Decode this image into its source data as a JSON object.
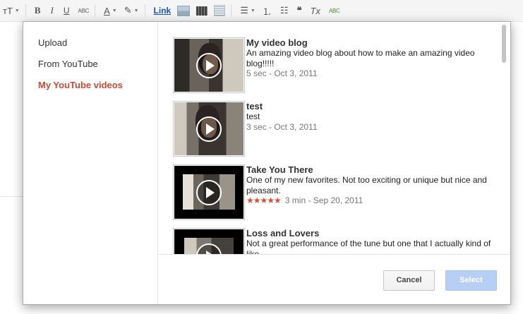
{
  "toolbar": {
    "font_size_label": "тT",
    "bold_label": "B",
    "italic_label": "I",
    "underline_label": "U",
    "strikethrough_label": "ABC",
    "text_color_label": "A",
    "link_label": "Link",
    "quote_label": "66",
    "clear_format_label": "Tx",
    "spellcheck_label": "ABC"
  },
  "dialog": {
    "sidebar": {
      "items": [
        {
          "label": "Upload",
          "active": false
        },
        {
          "label": "From YouTube",
          "active": false
        },
        {
          "label": "My YouTube videos",
          "active": true
        }
      ]
    },
    "videos": [
      {
        "title": "My video blog",
        "description": "An amazing video blog about how to make an amazing video blog!!!!!",
        "meta": "5 sec - Oct 3, 2011",
        "rating": null,
        "thumb_colors": [
          "#5a5550",
          "#2a2624",
          "#d9d4cc"
        ]
      },
      {
        "title": "test",
        "description": "test",
        "meta": "3 sec - Oct 3, 2011",
        "rating": null,
        "thumb_colors": [
          "#77716a",
          "#2c2826",
          "#c9c3ba"
        ]
      },
      {
        "title": "Take You There",
        "description": "One of my new favorites. Not too exciting or unique but nice and pleasant.",
        "meta": "3 min - Sep 20, 2011",
        "rating": 5,
        "stars": "★★★★★",
        "thumb_colors": [
          "#000000",
          "#6b655c",
          "#e6e1d8"
        ]
      },
      {
        "title": "Loss and Lovers",
        "description": "Not a great performance of the tune but one that I actually kind of like.",
        "meta": "",
        "rating": null,
        "thumb_colors": [
          "#000000",
          "#7c786f",
          "#cfcac1"
        ]
      }
    ],
    "buttons": {
      "cancel": "Cancel",
      "select": "Select"
    },
    "colors": {
      "active_nav": "#d14836",
      "select_button_disabled": "#b8cff5",
      "star": "#dd4b39"
    }
  }
}
